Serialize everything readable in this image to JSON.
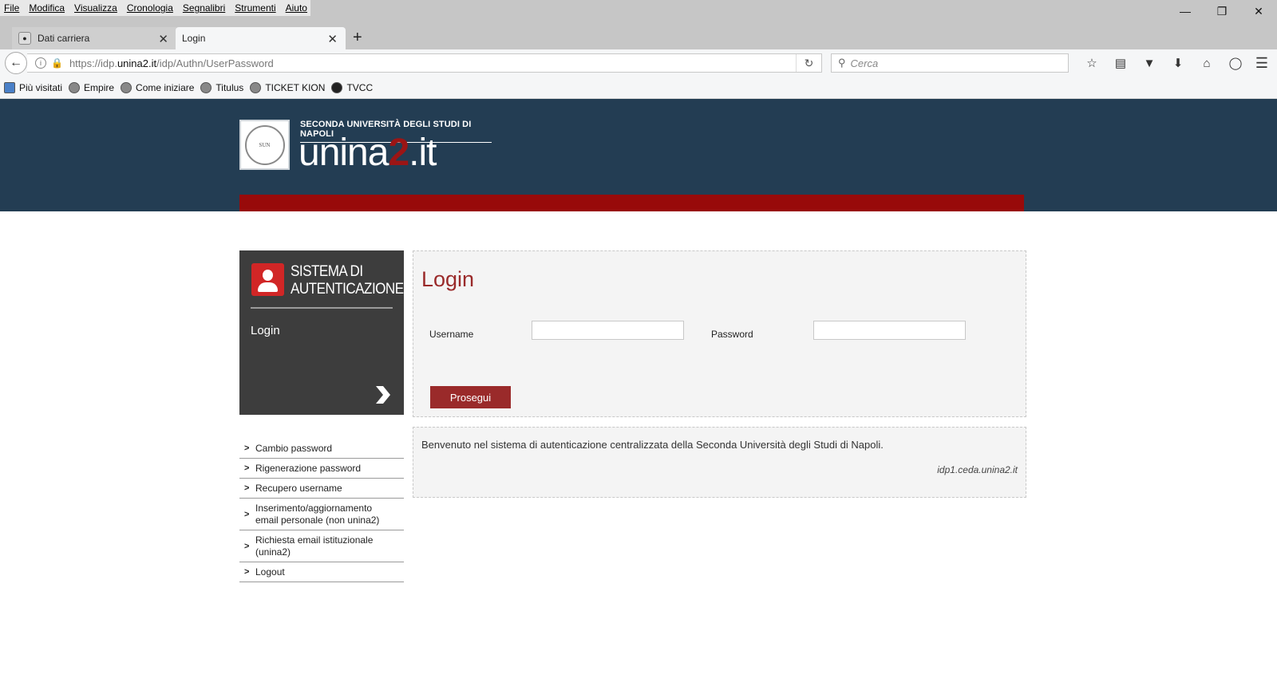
{
  "browser": {
    "menu": [
      "File",
      "Modifica",
      "Visualizza",
      "Cronologia",
      "Segnalibri",
      "Strumenti",
      "Aiuto"
    ],
    "tabs": [
      {
        "label": "Dati carriera",
        "active": false
      },
      {
        "label": "Login",
        "active": true
      }
    ],
    "url": {
      "prefix": "https://idp.",
      "domain": "unina2.it",
      "path": "/idp/Authn/UserPassword"
    },
    "search_placeholder": "Cerca",
    "bookmarks": [
      "Più visitati",
      "Empire",
      "Come iniziare",
      "Titulus",
      "TICKET KION",
      "TVCC"
    ]
  },
  "header": {
    "subtitle": "SECONDA UNIVERSITÀ DEGLI STUDI DI NAPOLI",
    "brand_prefix": "unina",
    "brand_number": "2",
    "brand_suffix": ".it",
    "seal_text": "SUN"
  },
  "sidebar": {
    "title_line1": "SISTEMA DI",
    "title_line2": "AUTENTICAZIONE",
    "current": "Login",
    "links": [
      "Cambio password",
      "Rigenerazione password",
      "Recupero username",
      "Inserimento/aggiornamento email personale (non unina2)",
      "Richiesta email istituzionale (unina2)",
      "Logout"
    ]
  },
  "login": {
    "title": "Login",
    "username_label": "Username",
    "password_label": "Password",
    "username_value": "",
    "password_value": "",
    "submit_label": "Prosegui"
  },
  "info": {
    "welcome": "Benvenuto nel sistema di autenticazione centralizzata della Seconda Università degli Studi di Napoli.",
    "host": "idp1.ceda.unina2.it"
  },
  "colors": {
    "header_bg": "#233d53",
    "accent_red": "#980a0a",
    "title_red": "#9a2a2a",
    "sidebar_bg": "#3d3d3d"
  }
}
